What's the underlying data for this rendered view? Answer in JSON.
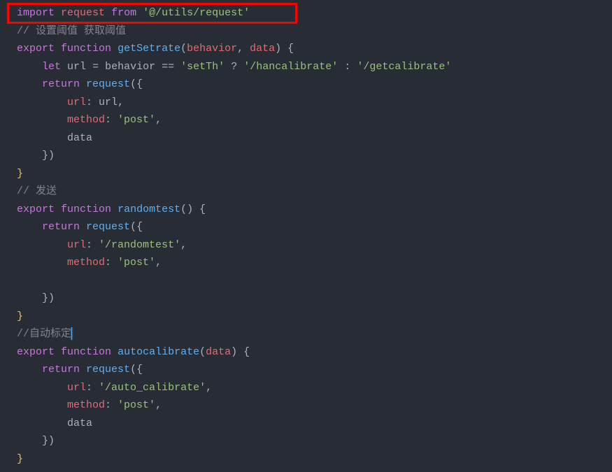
{
  "code": {
    "line1": {
      "import": "import",
      "request": "request",
      "from": "from",
      "path": "'@/utils/request'"
    },
    "line2": {
      "comment": "// 设置阈值 获取阈值"
    },
    "line3": {
      "export": "export",
      "function": "function",
      "name": "getSetrate",
      "param1": "behavior",
      "comma": ",",
      "param2": "data",
      "close": ") {"
    },
    "line4": {
      "let": "let",
      "url": "url",
      "eq": "=",
      "behavior": "behavior",
      "cmp": "==",
      "setth": "'setTh'",
      "q": "?",
      "hancal": "'/hancalibrate'",
      "colon": ":",
      "getcal": "'/getcalibrate'"
    },
    "line5": {
      "return": "return",
      "request": "request",
      "open": "({"
    },
    "line6": {
      "key": "url",
      "val": "url",
      "comma": ","
    },
    "line7": {
      "key": "method",
      "val": "'post'",
      "comma": ","
    },
    "line8": {
      "key": "data"
    },
    "line9": {
      "close": "})"
    },
    "line10": {
      "brace": "}"
    },
    "line11": {
      "comment": "// 发送"
    },
    "line12": {
      "export": "export",
      "function": "function",
      "name": "randomtest",
      "params": "()",
      "open": "{"
    },
    "line13": {
      "return": "return",
      "request": "request",
      "open": "({"
    },
    "line14": {
      "key": "url",
      "val": "'/randomtest'",
      "comma": ","
    },
    "line15": {
      "key": "method",
      "val": "'post'",
      "comma": ","
    },
    "line16": {
      "blank": ""
    },
    "line17": {
      "close": "})"
    },
    "line18": {
      "brace": "}"
    },
    "line19": {
      "comment": "//自动标定"
    },
    "line20": {
      "export": "export",
      "function": "function",
      "name": "autocalibrate",
      "param": "data",
      "close": ") {"
    },
    "line21": {
      "return": "return",
      "request": "request",
      "open": "({"
    },
    "line22": {
      "key": "url",
      "val": "'/auto_calibrate'",
      "comma": ","
    },
    "line23": {
      "key": "method",
      "val": "'post'",
      "comma": ","
    },
    "line24": {
      "key": "data"
    },
    "line25": {
      "close": "})"
    },
    "line26": {
      "brace": "}"
    }
  }
}
